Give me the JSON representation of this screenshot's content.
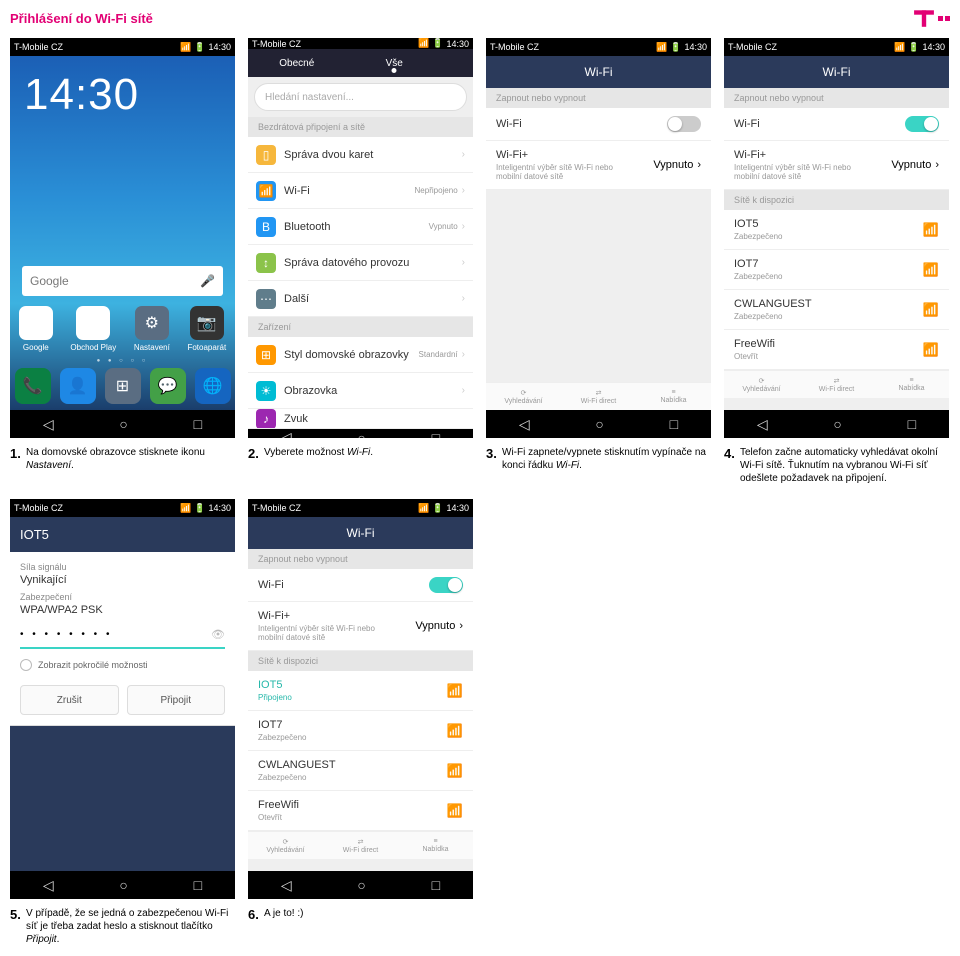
{
  "page_title": "Přihlášení do Wi-Fi sítě",
  "status": {
    "carrier": "T-Mobile CZ",
    "time": "14:30"
  },
  "nav": {
    "back": "◁",
    "home": "○",
    "recent": "□"
  },
  "captions": [
    {
      "n": "1.",
      "t": "Na domovské obrazovce stisknete ikonu <em>Nastavení</em>."
    },
    {
      "n": "2.",
      "t": "Vyberete možnost <em>Wi-Fi</em>."
    },
    {
      "n": "3.",
      "t": "Wi-Fi zapnete/vypnete stisknutím vypínače na konci řádku <em>Wi-Fi</em>."
    },
    {
      "n": "4.",
      "t": "Telefon začne automaticky vyhledávat okolní Wi-Fi sítě. Ťuknutím na vybranou Wi-Fi síť odešlete požadavek na připojení."
    },
    {
      "n": "5.",
      "t": "V případě, že se jedná o zabezpečenou Wi-Fi síť je třeba zadat heslo a stisknout tlačítko <em>Připojit</em>."
    },
    {
      "n": "6.",
      "t": "A je to! :)"
    }
  ],
  "home": {
    "clock": "14:30",
    "google": "Google",
    "apps": [
      "Google",
      "Obchod Play",
      "Nastavení",
      "Fotoaparát"
    ]
  },
  "settings": {
    "tabs": [
      "Obecné",
      "Vše"
    ],
    "search_ph": "Hledání nastavení...",
    "section1": "Bezdrátová připojení a sítě",
    "rows": [
      {
        "label": "Správa dvou karet",
        "val": "",
        "color": "#f6b73c"
      },
      {
        "label": "Wi-Fi",
        "val": "Nepřipojeno",
        "color": "#2196f3"
      },
      {
        "label": "Bluetooth",
        "val": "Vypnuto",
        "color": "#2196f3"
      },
      {
        "label": "Správa datového provozu",
        "val": "",
        "color": "#8bc34a"
      },
      {
        "label": "Další",
        "val": "",
        "color": "#607d8b"
      }
    ],
    "section2": "Zařízení",
    "rows2": [
      {
        "label": "Styl domovské obrazovky",
        "val": "Standardní",
        "color": "#ff9800"
      },
      {
        "label": "Obrazovka",
        "val": "",
        "color": "#00bcd4"
      },
      {
        "label": "Zvuk",
        "val": "",
        "color": "#9c27b0"
      }
    ]
  },
  "wifi": {
    "title": "Wi-Fi",
    "toggle_section": "Zapnout nebo vypnout",
    "wifi_label": "Wi-Fi",
    "wplus_label": "Wi-Fi+",
    "wplus_desc": "Inteligentní výběr sítě Wi-Fi nebo mobilní datové sítě",
    "wplus_val": "Vypnuto",
    "avail_section": "Sítě k dispozici",
    "nets": [
      {
        "name": "IOT5",
        "sec": "Zabezpečeno",
        "conn": ""
      },
      {
        "name": "IOT7",
        "sec": "Zabezpečeno",
        "conn": ""
      },
      {
        "name": "CWLANGUEST",
        "sec": "Zabezpečeno",
        "conn": ""
      },
      {
        "name": "FreeWifi",
        "sec": "Otevřít",
        "conn": ""
      }
    ],
    "bbar": [
      "Vyhledávání",
      "Wi-Fi direct",
      "Nabídka"
    ],
    "bicons": [
      "⟳",
      "⇄",
      "≡"
    ]
  },
  "wifi6_nets": [
    {
      "name": "IOT5",
      "sec": "Připojeno",
      "sel": true
    },
    {
      "name": "IOT7",
      "sec": "Zabezpečeno"
    },
    {
      "name": "CWLANGUEST",
      "sec": "Zabezpečeno"
    },
    {
      "name": "FreeWifi",
      "sec": "Otevřít"
    }
  ],
  "pw": {
    "net": "IOT5",
    "sig_lbl": "Síla signálu",
    "sig_val": "Vynikající",
    "sec_lbl": "Zabezpečení",
    "sec_val": "WPA/WPA2 PSK",
    "dots": "• • • • • • • •",
    "adv": "Zobrazit pokročilé možnosti",
    "cancel": "Zrušit",
    "connect": "Připojit"
  }
}
